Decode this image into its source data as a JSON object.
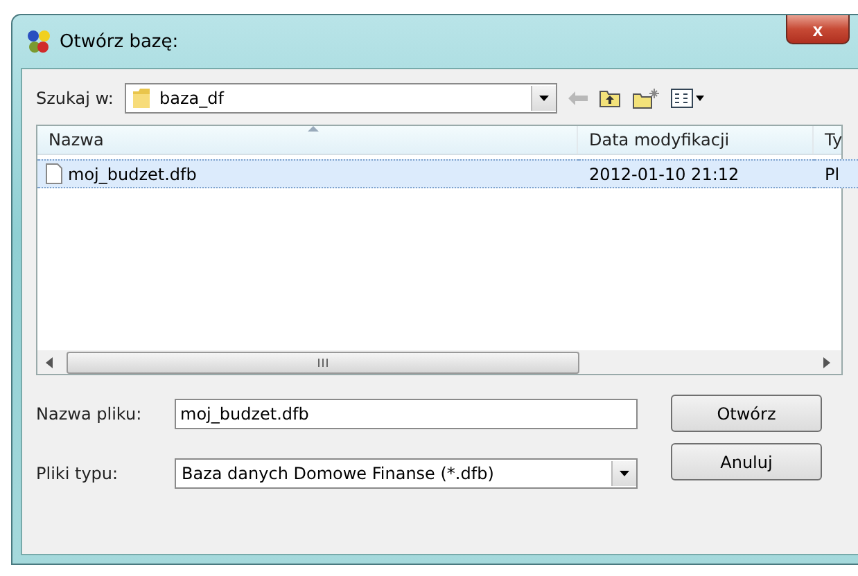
{
  "window": {
    "title": "Otwórz bazę:",
    "close": "x"
  },
  "look_in": {
    "label": "Szukaj w:",
    "value": "baza_df"
  },
  "file_list": {
    "columns": [
      {
        "label": "Nazwa",
        "sorted": true
      },
      {
        "label": "Data modyfikacji",
        "sorted": false
      },
      {
        "label": "Ty",
        "sorted": false
      }
    ],
    "rows": [
      {
        "name": "moj_budzet.dfb",
        "date": "2012-01-10 21:12",
        "type": "Pl",
        "selected": true
      }
    ]
  },
  "file_name": {
    "label": "Nazwa pliku:",
    "value": "moj_budzet.dfb"
  },
  "file_type": {
    "label": "Pliki typu:",
    "value": "Baza danych Domowe Finanse (*.dfb)"
  },
  "buttons": [
    "Otwórz",
    "Anuluj"
  ]
}
